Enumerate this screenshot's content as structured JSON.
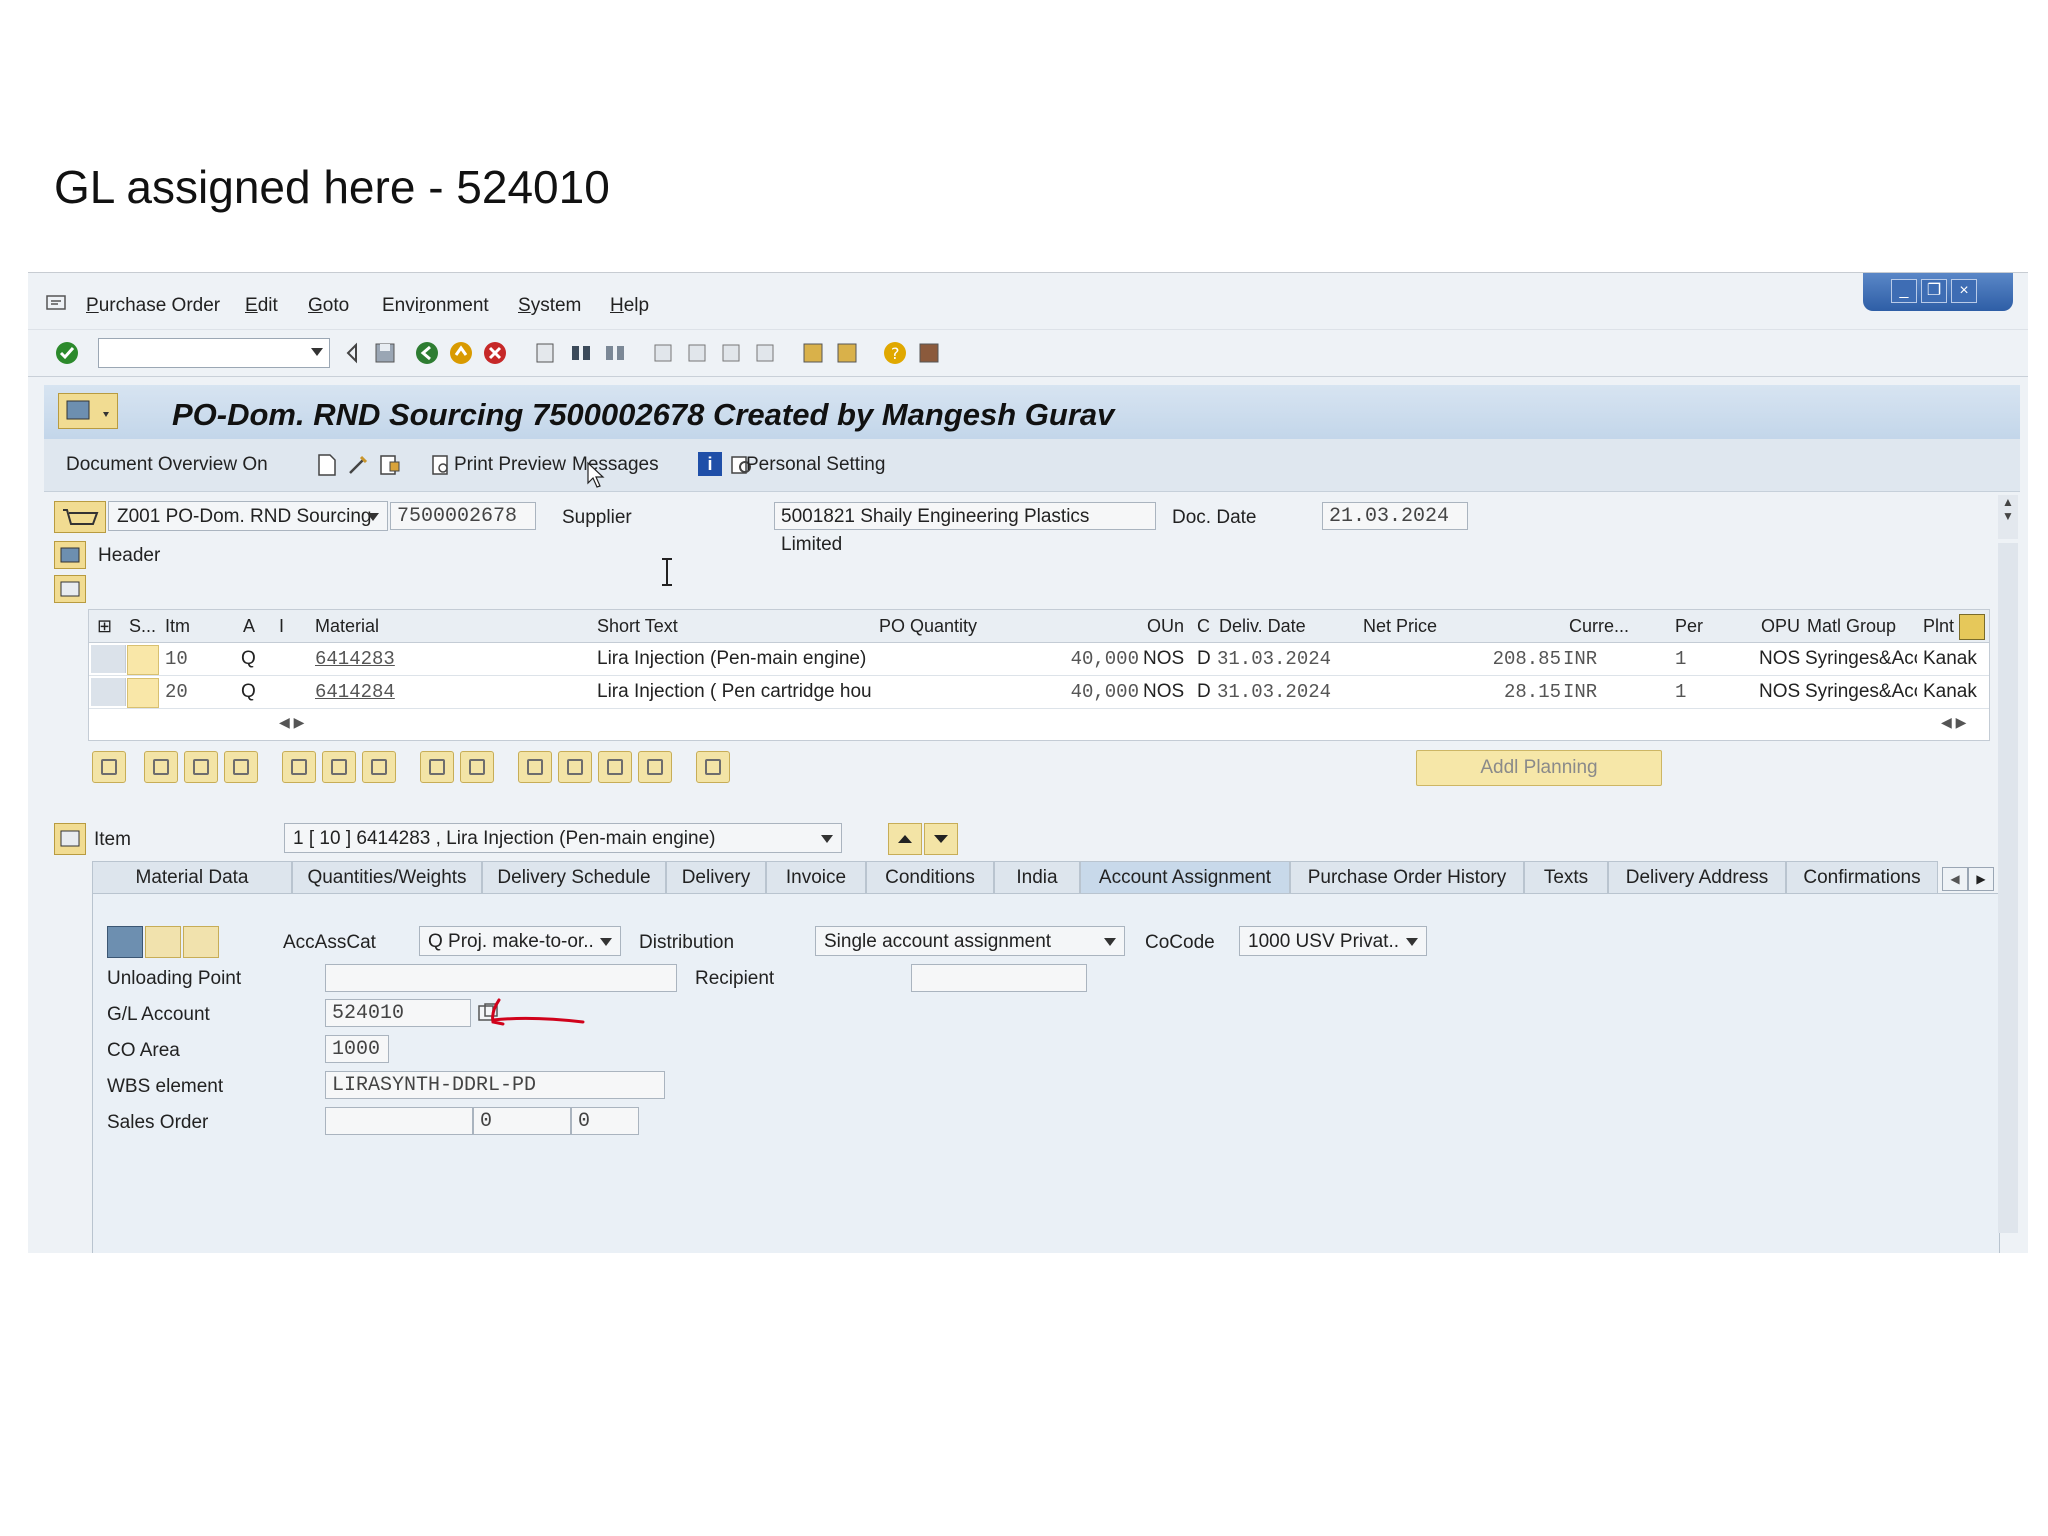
{
  "caption": "GL assigned here - 524010",
  "menu": [
    {
      "label": "Purchase Order",
      "accel": "P",
      "rest": "urchase Order"
    },
    {
      "label": "Edit",
      "accel": "E",
      "rest": "dit"
    },
    {
      "label": "Goto",
      "accel": "G",
      "rest": "oto"
    },
    {
      "label": "Environment",
      "pre": "Envi",
      "accel": "r",
      "rest": "onment"
    },
    {
      "label": "System",
      "accel": "S",
      "rest": "ystem"
    },
    {
      "label": "Help",
      "accel": "H",
      "rest": "elp"
    }
  ],
  "title": "PO-Dom. RND Sourcing 7500002678 Created by Mangesh Gurav",
  "appbar": {
    "doc_overview": "Document Overview On",
    "print_preview": "Print Preview",
    "messages": "Messages",
    "personal_setting": "Personal Setting"
  },
  "header": {
    "doc_type": "Z001 PO-Dom. RND Sourcing",
    "po_number": "7500002678",
    "supplier_label": "Supplier",
    "supplier_value": "5001821 Shaily Engineering Plastics Limited",
    "doc_date_label": "Doc. Date",
    "doc_date_value": "21.03.2024",
    "header_label": "Header"
  },
  "items_table": {
    "columns": [
      "S...",
      "Itm",
      "A",
      "I",
      "Material",
      "Short Text",
      "PO Quantity",
      "OUn",
      "C",
      "Deliv. Date",
      "Net Price",
      "Curre...",
      "Per",
      "OPU",
      "Matl Group",
      "Plnt"
    ],
    "rows": [
      {
        "itm": "10",
        "a": "Q",
        "material": "6414283",
        "short_text": "Lira Injection (Pen-main engine)",
        "qty": "40,000",
        "oun": "NOS",
        "c": "D",
        "deliv": "31.03.2024",
        "price": "208.85",
        "curr": "INR",
        "per": "1",
        "opu": "NOS",
        "matl_group": "Syringes&Access",
        "plnt": "Kanakpu"
      },
      {
        "itm": "20",
        "a": "Q",
        "material": "6414284",
        "short_text": "Lira Injection ( Pen cartridge hou",
        "qty": "40,000",
        "oun": "NOS",
        "c": "D",
        "deliv": "31.03.2024",
        "price": "28.15",
        "curr": "INR",
        "per": "1",
        "opu": "NOS",
        "matl_group": "Syringes&Access",
        "plnt": "Kanakpu"
      }
    ]
  },
  "addl_planning": "Addl Planning",
  "item_section": {
    "label": "Item",
    "selected": "1 [ 10 ] 6414283 , Lira Injection (Pen-main engine)"
  },
  "tabs": [
    "Material Data",
    "Quantities/Weights",
    "Delivery Schedule",
    "Delivery",
    "Invoice",
    "Conditions",
    "India",
    "Account Assignment",
    "Purchase Order History",
    "Texts",
    "Delivery Address",
    "Confirmations"
  ],
  "active_tab": "Account Assignment",
  "account_assignment": {
    "accasscat_label": "AccAssCat",
    "accasscat_value": "Q Proj. make-to-or..",
    "distribution_label": "Distribution",
    "distribution_value": "Single account assignment",
    "cocode_label": "CoCode",
    "cocode_value": "1000 USV Privat..",
    "unloading_point_label": "Unloading Point",
    "unloading_point_value": "",
    "recipient_label": "Recipient",
    "recipient_value": "",
    "gl_account_label": "G/L Account",
    "gl_account_value": "524010",
    "co_area_label": "CO Area",
    "co_area_value": "1000",
    "wbs_label": "WBS element",
    "wbs_value": "LIRASYNTH-DDRL-PD",
    "sales_order_label": "Sales Order",
    "sales_order_value": "",
    "sales_order_item": "0",
    "sales_order_sched": "0"
  },
  "colors": {
    "annotation_red": "#d0021b",
    "title_bg": "#c3d6ea",
    "button_yellow": "#f3e4a6"
  }
}
